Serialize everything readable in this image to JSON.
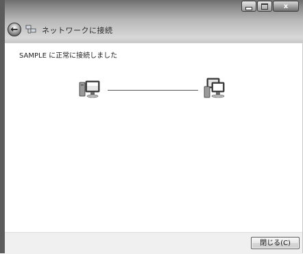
{
  "window": {
    "title": "ネットワークに接続"
  },
  "caption_buttons": {
    "close_glyph": "x"
  },
  "nav": {
    "back_glyph": "←"
  },
  "main": {
    "message": "SAMPLE に正常に接続しました"
  },
  "footer": {
    "close_label": "閉じる(C)"
  },
  "icons": {
    "left": "computer-icon",
    "right": "network-computers-icon"
  }
}
